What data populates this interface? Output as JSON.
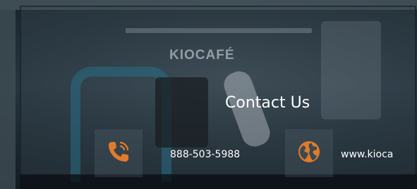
{
  "brand": {
    "logo_text": "KIOCAFÉ"
  },
  "contact": {
    "title": "Contact Us",
    "phone": {
      "icon": "phone-icon",
      "text": "888-503-5988"
    },
    "website": {
      "icon": "globe-icon",
      "text": "www.kioca"
    }
  },
  "colors": {
    "accent_orange": "#e07b2a",
    "text": "#ffffff"
  }
}
